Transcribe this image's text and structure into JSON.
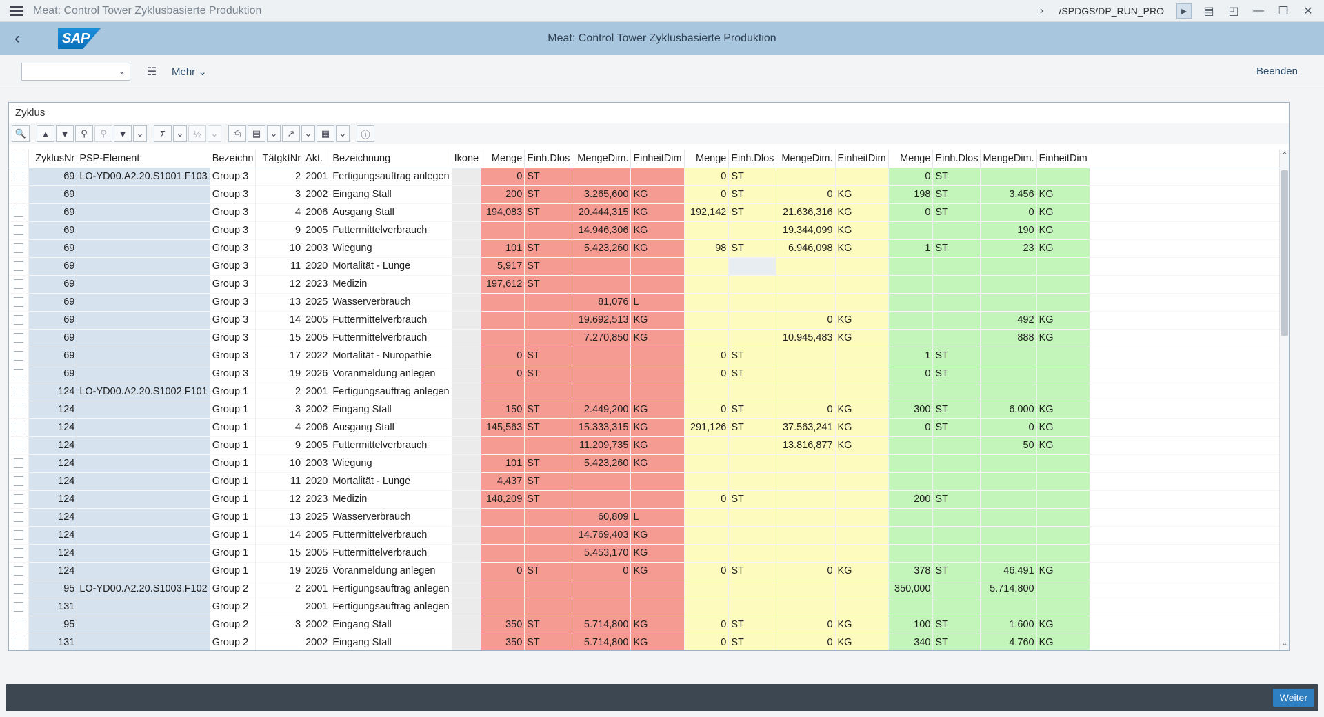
{
  "titlebar": {
    "title": "Meat: Control Tower Zyklusbasierte Produktion",
    "tcode": "/SPDGS/DP_RUN_PRO"
  },
  "header": {
    "logo": "SAP",
    "title": "Meat: Control Tower Zyklusbasierte Produktion"
  },
  "toolbar": {
    "combo_value": "",
    "more_label": "Mehr",
    "exit_label": "Beenden"
  },
  "panel": {
    "title": "Zyklus"
  },
  "columns": [
    "ZyklusNr",
    "PSP-Element",
    "Bezeichn",
    "TätgktNr",
    "Akt.",
    "Bezeichnung",
    "Ikone",
    "Menge",
    "Einh.Dlos",
    "MengeDim.",
    "EinheitDim",
    "Menge",
    "Einh.Dlos",
    "MengeDim.",
    "EinheitDim",
    "Menge",
    "Einh.Dlos",
    "MengeDim.",
    "EinheitDim"
  ],
  "rows": [
    [
      "69",
      "LO-YD00.A2.20.S1001.F103",
      "Group 3",
      "2",
      "2001",
      "Fertigungsauftrag anlegen",
      "",
      "0",
      "ST",
      "",
      "",
      "0",
      "ST",
      "",
      "",
      "0",
      "ST",
      "",
      ""
    ],
    [
      "69",
      "",
      "Group 3",
      "3",
      "2002",
      "Eingang Stall",
      "",
      "200",
      "ST",
      "3.265,600",
      "KG",
      "0",
      "ST",
      "0",
      "KG",
      "198",
      "ST",
      "3.456",
      "KG"
    ],
    [
      "69",
      "",
      "Group 3",
      "4",
      "2006",
      "Ausgang Stall",
      "",
      "194,083",
      "ST",
      "20.444,315",
      "KG",
      "192,142",
      "ST",
      "21.636,316",
      "KG",
      "0",
      "ST",
      "0",
      "KG"
    ],
    [
      "69",
      "",
      "Group 3",
      "9",
      "2005",
      "Futtermittelverbrauch",
      "",
      "",
      "",
      "14.946,306",
      "KG",
      "",
      "",
      "19.344,099",
      "KG",
      "",
      "",
      "190",
      "KG"
    ],
    [
      "69",
      "",
      "Group 3",
      "10",
      "2003",
      "Wiegung",
      "",
      "101",
      "ST",
      "5.423,260",
      "KG",
      "98",
      "ST",
      "6.946,098",
      "KG",
      "1",
      "ST",
      "23",
      "KG"
    ],
    [
      "69",
      "",
      "Group 3",
      "11",
      "2020",
      "Mortalität - Lunge",
      "",
      "5,917",
      "ST",
      "",
      "",
      "",
      "",
      "",
      "",
      "",
      "",
      "",
      ""
    ],
    [
      "69",
      "",
      "Group 3",
      "12",
      "2023",
      "Medizin",
      "",
      "197,612",
      "ST",
      "",
      "",
      "",
      "",
      "",
      "",
      "",
      "",
      "",
      ""
    ],
    [
      "69",
      "",
      "Group 3",
      "13",
      "2025",
      "Wasserverbrauch",
      "",
      "",
      "",
      "81,076",
      "L",
      "",
      "",
      "",
      "",
      "",
      "",
      "",
      ""
    ],
    [
      "69",
      "",
      "Group 3",
      "14",
      "2005",
      "Futtermittelverbrauch",
      "",
      "",
      "",
      "19.692,513",
      "KG",
      "",
      "",
      "0",
      "KG",
      "",
      "",
      "492",
      "KG"
    ],
    [
      "69",
      "",
      "Group 3",
      "15",
      "2005",
      "Futtermittelverbrauch",
      "",
      "",
      "",
      "7.270,850",
      "KG",
      "",
      "",
      "10.945,483",
      "KG",
      "",
      "",
      "888",
      "KG"
    ],
    [
      "69",
      "",
      "Group 3",
      "17",
      "2022",
      "Mortalität - Nuropathie",
      "",
      "0",
      "ST",
      "",
      "",
      "0",
      "ST",
      "",
      "",
      "1",
      "ST",
      "",
      ""
    ],
    [
      "69",
      "",
      "Group 3",
      "19",
      "2026",
      "Voranmeldung anlegen",
      "",
      "0",
      "ST",
      "",
      "",
      "0",
      "ST",
      "",
      "",
      "0",
      "ST",
      "",
      ""
    ],
    [
      "124",
      "LO-YD00.A2.20.S1002.F101",
      "Group 1",
      "2",
      "2001",
      "Fertigungsauftrag anlegen",
      "",
      "",
      "",
      "",
      "",
      "",
      "",
      "",
      "",
      "",
      "",
      "",
      ""
    ],
    [
      "124",
      "",
      "Group 1",
      "3",
      "2002",
      "Eingang Stall",
      "",
      "150",
      "ST",
      "2.449,200",
      "KG",
      "0",
      "ST",
      "0",
      "KG",
      "300",
      "ST",
      "6.000",
      "KG"
    ],
    [
      "124",
      "",
      "Group 1",
      "4",
      "2006",
      "Ausgang Stall",
      "",
      "145,563",
      "ST",
      "15.333,315",
      "KG",
      "291,126",
      "ST",
      "37.563,241",
      "KG",
      "0",
      "ST",
      "0",
      "KG"
    ],
    [
      "124",
      "",
      "Group 1",
      "9",
      "2005",
      "Futtermittelverbrauch",
      "",
      "",
      "",
      "11.209,735",
      "KG",
      "",
      "",
      "13.816,877",
      "KG",
      "",
      "",
      "50",
      "KG"
    ],
    [
      "124",
      "",
      "Group 1",
      "10",
      "2003",
      "Wiegung",
      "",
      "101",
      "ST",
      "5.423,260",
      "KG",
      "",
      "",
      "",
      "",
      "",
      "",
      "",
      ""
    ],
    [
      "124",
      "",
      "Group 1",
      "11",
      "2020",
      "Mortalität - Lunge",
      "",
      "4,437",
      "ST",
      "",
      "",
      "",
      "",
      "",
      "",
      "",
      "",
      "",
      ""
    ],
    [
      "124",
      "",
      "Group 1",
      "12",
      "2023",
      "Medizin",
      "",
      "148,209",
      "ST",
      "",
      "",
      "0",
      "ST",
      "",
      "",
      "200",
      "ST",
      "",
      ""
    ],
    [
      "124",
      "",
      "Group 1",
      "13",
      "2025",
      "Wasserverbrauch",
      "",
      "",
      "",
      "60,809",
      "L",
      "",
      "",
      "",
      "",
      "",
      "",
      "",
      ""
    ],
    [
      "124",
      "",
      "Group 1",
      "14",
      "2005",
      "Futtermittelverbrauch",
      "",
      "",
      "",
      "14.769,403",
      "KG",
      "",
      "",
      "",
      "",
      "",
      "",
      "",
      ""
    ],
    [
      "124",
      "",
      "Group 1",
      "15",
      "2005",
      "Futtermittelverbrauch",
      "",
      "",
      "",
      "5.453,170",
      "KG",
      "",
      "",
      "",
      "",
      "",
      "",
      "",
      ""
    ],
    [
      "124",
      "",
      "Group 1",
      "19",
      "2026",
      "Voranmeldung anlegen",
      "",
      "0",
      "ST",
      "0",
      "KG",
      "0",
      "ST",
      "0",
      "KG",
      "378",
      "ST",
      "46.491",
      "KG"
    ],
    [
      "95",
      "LO-YD00.A2.20.S1003.F102",
      "Group 2",
      "2",
      "2001",
      "Fertigungsauftrag anlegen",
      "",
      "",
      "",
      "",
      "",
      "",
      "",
      "",
      "",
      "350,000",
      "",
      "5.714,800",
      ""
    ],
    [
      "131",
      "",
      "Group 2",
      "",
      "2001",
      "Fertigungsauftrag anlegen",
      "",
      "",
      "",
      "",
      "",
      "",
      "",
      "",
      "",
      "",
      "",
      "",
      ""
    ],
    [
      "95",
      "",
      "Group 2",
      "3",
      "2002",
      "Eingang Stall",
      "",
      "350",
      "ST",
      "5.714,800",
      "KG",
      "0",
      "ST",
      "0",
      "KG",
      "100",
      "ST",
      "1.600",
      "KG"
    ],
    [
      "131",
      "",
      "Group 2",
      "",
      "2002",
      "Eingang Stall",
      "",
      "350",
      "ST",
      "5.714,800",
      "KG",
      "0",
      "ST",
      "0",
      "KG",
      "340",
      "ST",
      "4.760",
      "KG"
    ]
  ],
  "footer": {
    "continue_label": "Weiter"
  },
  "colors": {
    "header": "#a9c6df",
    "red": "#f69b92",
    "yellow": "#fdfbbe",
    "green": "#c3f5ba",
    "blue": "#d6e2ee"
  }
}
